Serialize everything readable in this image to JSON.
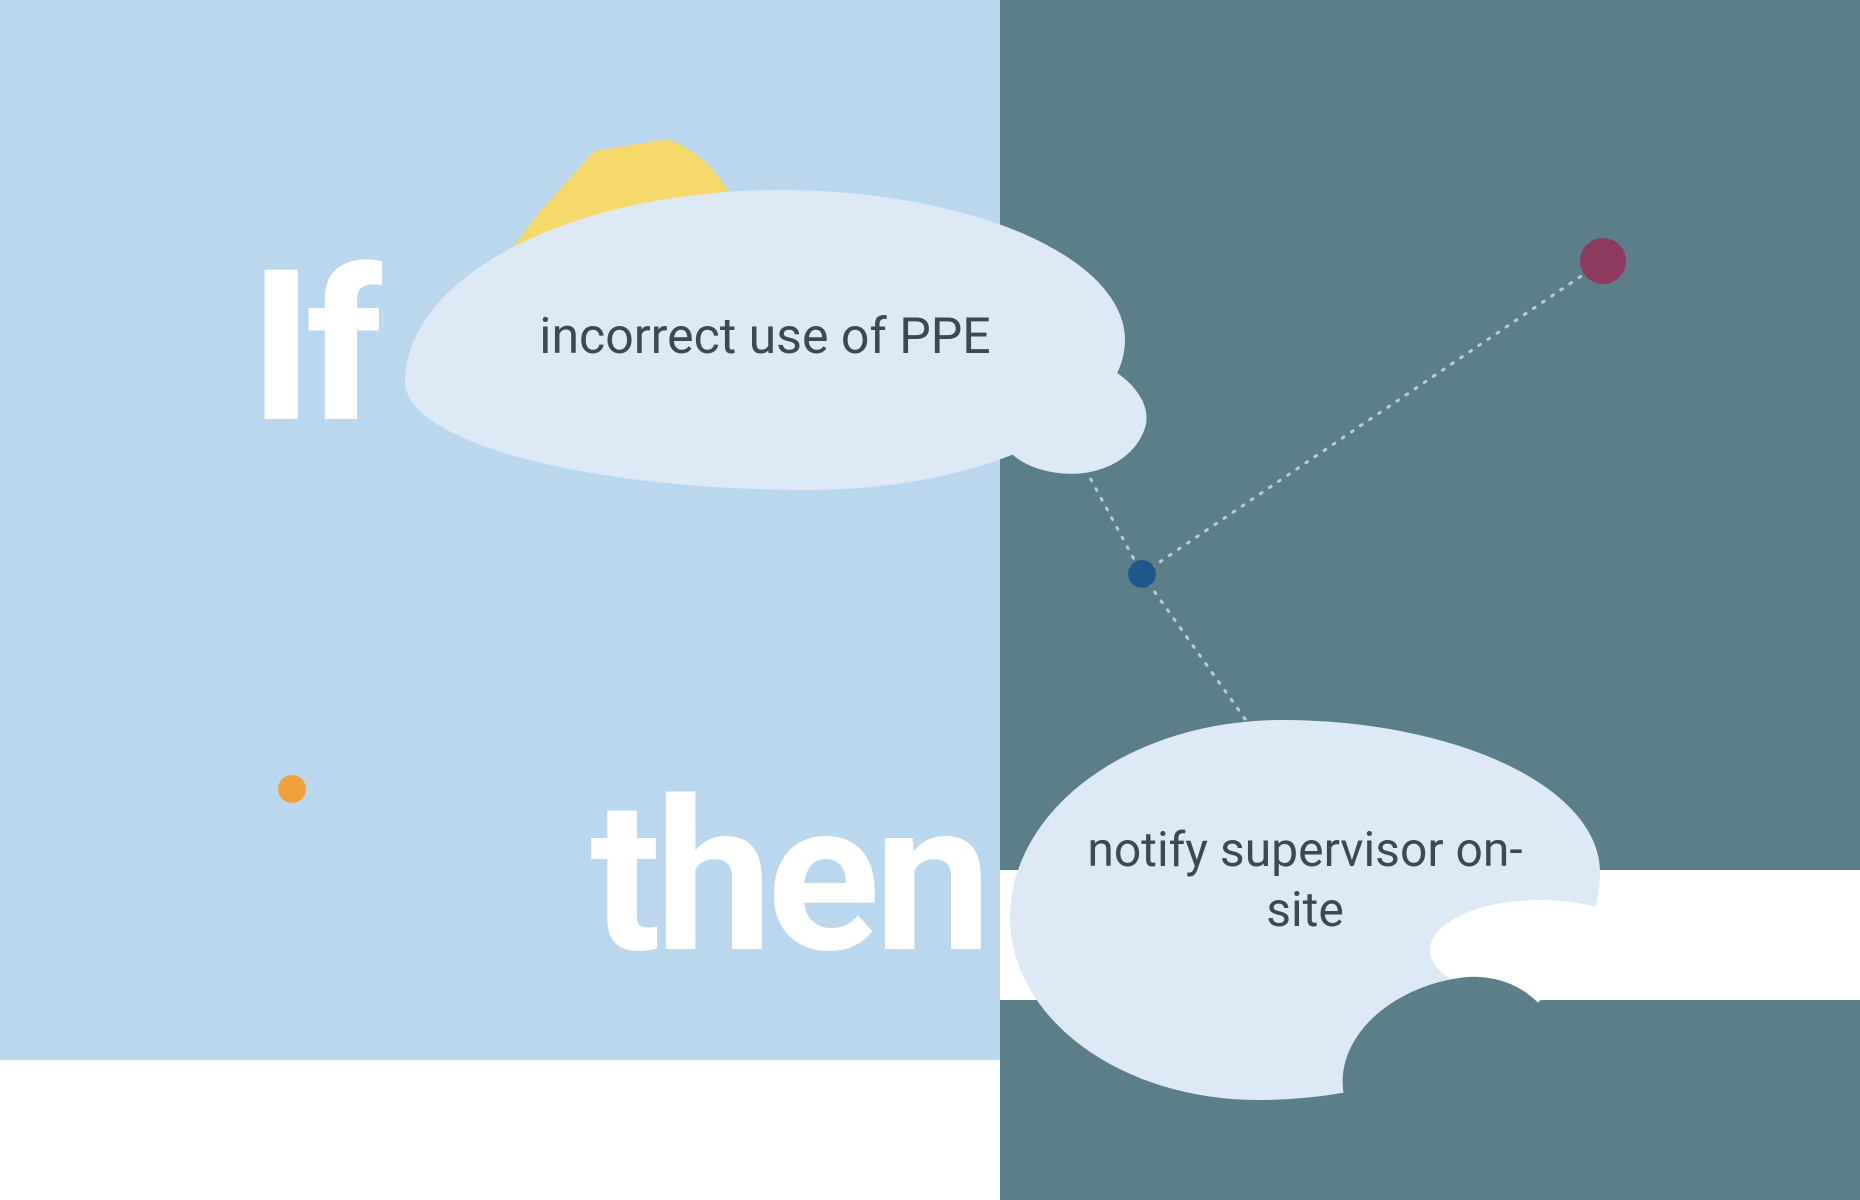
{
  "labels": {
    "if": "If",
    "then": "then"
  },
  "condition": {
    "text": "incorrect use of PPE"
  },
  "action": {
    "text": "notify supervisor on-site"
  },
  "colors": {
    "panel_left": "#bbd7ee",
    "panel_right": "#5b7e88",
    "blob": "#dde9f5",
    "sun": "#f6d96b",
    "dot_orange": "#f0a13b",
    "dot_blue": "#1e578b",
    "dot_maroon": "#8e3a5e",
    "text": "#3a4a55"
  }
}
